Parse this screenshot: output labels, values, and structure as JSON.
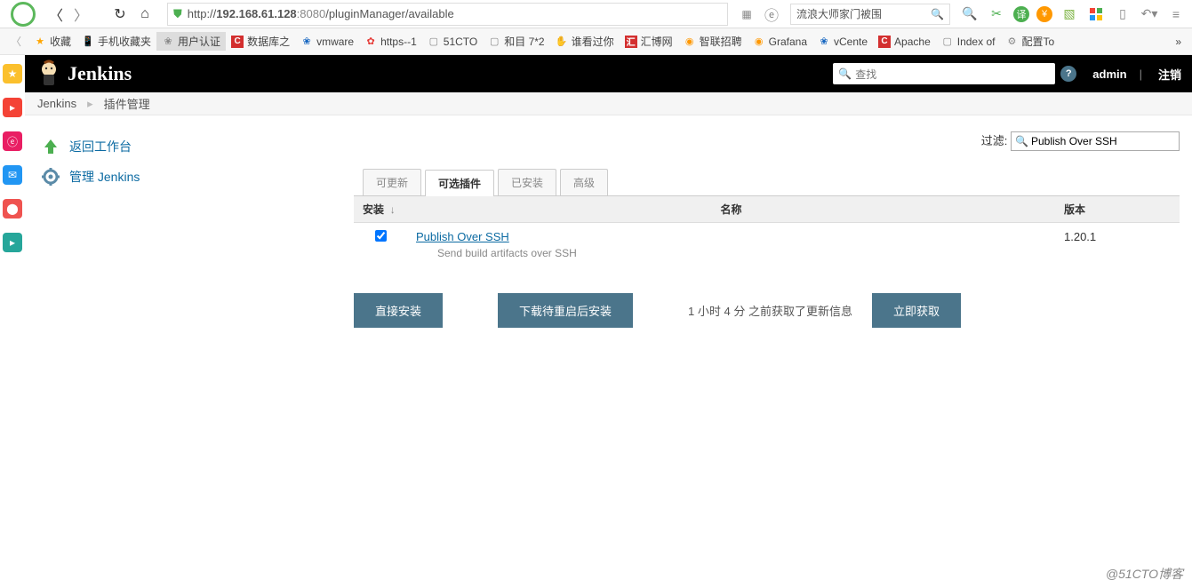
{
  "browser": {
    "url_prefix": "http://",
    "url_host": "192.168.61.128",
    "url_port": ":8080",
    "url_path": "/pluginManager/available",
    "search_text": "流浪大师家门被围"
  },
  "bookmarks": [
    {
      "label": "收藏",
      "icon": "star",
      "color": "#ffa500"
    },
    {
      "label": "手机收藏夹",
      "icon": "phone",
      "color": "#4caf50"
    },
    {
      "label": "用户认证",
      "icon": "paw",
      "color": "#888",
      "active": true
    },
    {
      "label": "数据库之",
      "icon": "C",
      "color": "#d32f2f"
    },
    {
      "label": "vmware",
      "icon": "paw",
      "color": "#1565c0"
    },
    {
      "label": "https--1",
      "icon": "flower",
      "color": "#e53935"
    },
    {
      "label": "51CTO",
      "icon": "page",
      "color": "#888"
    },
    {
      "label": "和目 7*2",
      "icon": "page",
      "color": "#888"
    },
    {
      "label": "谁看过你",
      "icon": "hand",
      "color": "#ff7043"
    },
    {
      "label": "汇博网",
      "icon": "汇",
      "color": "#d32f2f"
    },
    {
      "label": "智联招聘",
      "icon": "bulb",
      "color": "#ff9800"
    },
    {
      "label": "Grafana",
      "icon": "swirl",
      "color": "#ff9800"
    },
    {
      "label": "vCente",
      "icon": "paw",
      "color": "#1565c0"
    },
    {
      "label": "Apache",
      "icon": "C",
      "color": "#d32f2f"
    },
    {
      "label": "Index of",
      "icon": "page",
      "color": "#888"
    },
    {
      "label": "配置To",
      "icon": "gears",
      "color": "#888"
    }
  ],
  "jenkins": {
    "brand": "Jenkins",
    "search_placeholder": "查找",
    "user": "admin",
    "logout": "注销"
  },
  "breadcrumbs": [
    "Jenkins",
    "插件管理"
  ],
  "sidebar": {
    "back": "返回工作台",
    "manage": "管理 Jenkins"
  },
  "filter": {
    "label": "过滤:",
    "value": "Publish Over SSH"
  },
  "tabs": [
    "可更新",
    "可选插件",
    "已安装",
    "高级"
  ],
  "active_tab": 1,
  "table": {
    "headers": {
      "install": "安装",
      "sort": "↓",
      "name": "名称",
      "version": "版本"
    },
    "rows": [
      {
        "checked": true,
        "name": "Publish Over SSH",
        "desc": "Send build artifacts over SSH",
        "version": "1.20.1"
      }
    ]
  },
  "buttons": {
    "direct": "直接安装",
    "download": "下载待重启后安装",
    "check_now": "立即获取"
  },
  "status": "1 小时 4 分 之前获取了更新信息",
  "watermark": "@51CTO博客"
}
